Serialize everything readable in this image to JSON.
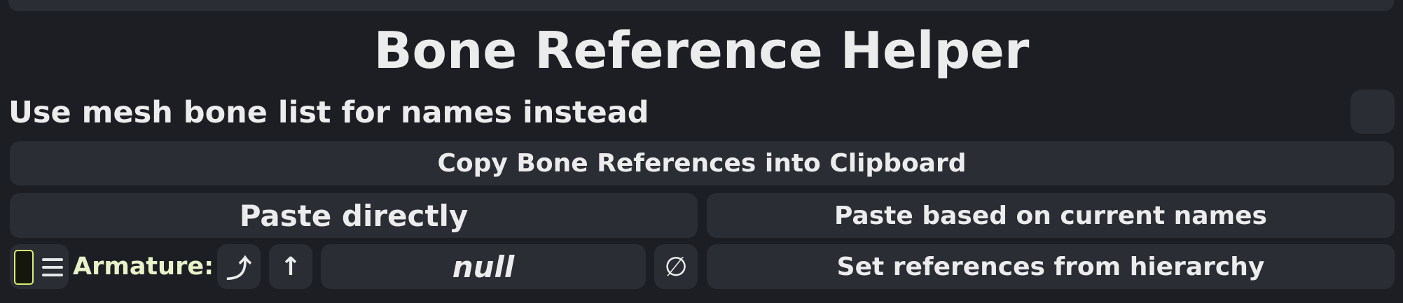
{
  "panel": {
    "title": "Bone Reference Helper"
  },
  "options": {
    "mesh_bone_label": "Use mesh bone list for names instead",
    "mesh_bone_checked": false
  },
  "actions": {
    "copy_label": "Copy Bone References into Clipboard",
    "paste_direct_label": "Paste directly",
    "paste_names_label": "Paste based on current names",
    "set_refs_label": "Set references from hierarchy"
  },
  "armature": {
    "label": "Armature:",
    "value": "null",
    "select_parent_glyph": "⤴",
    "select_up_glyph": "↑",
    "clear_glyph": "∅",
    "swatch_color": "#d8f070"
  },
  "icons": {
    "menu": "hamburger-icon",
    "select_parent": "arrow-up-right-hook-icon",
    "select_up": "arrow-up-icon",
    "clear": "null-set-icon"
  }
}
